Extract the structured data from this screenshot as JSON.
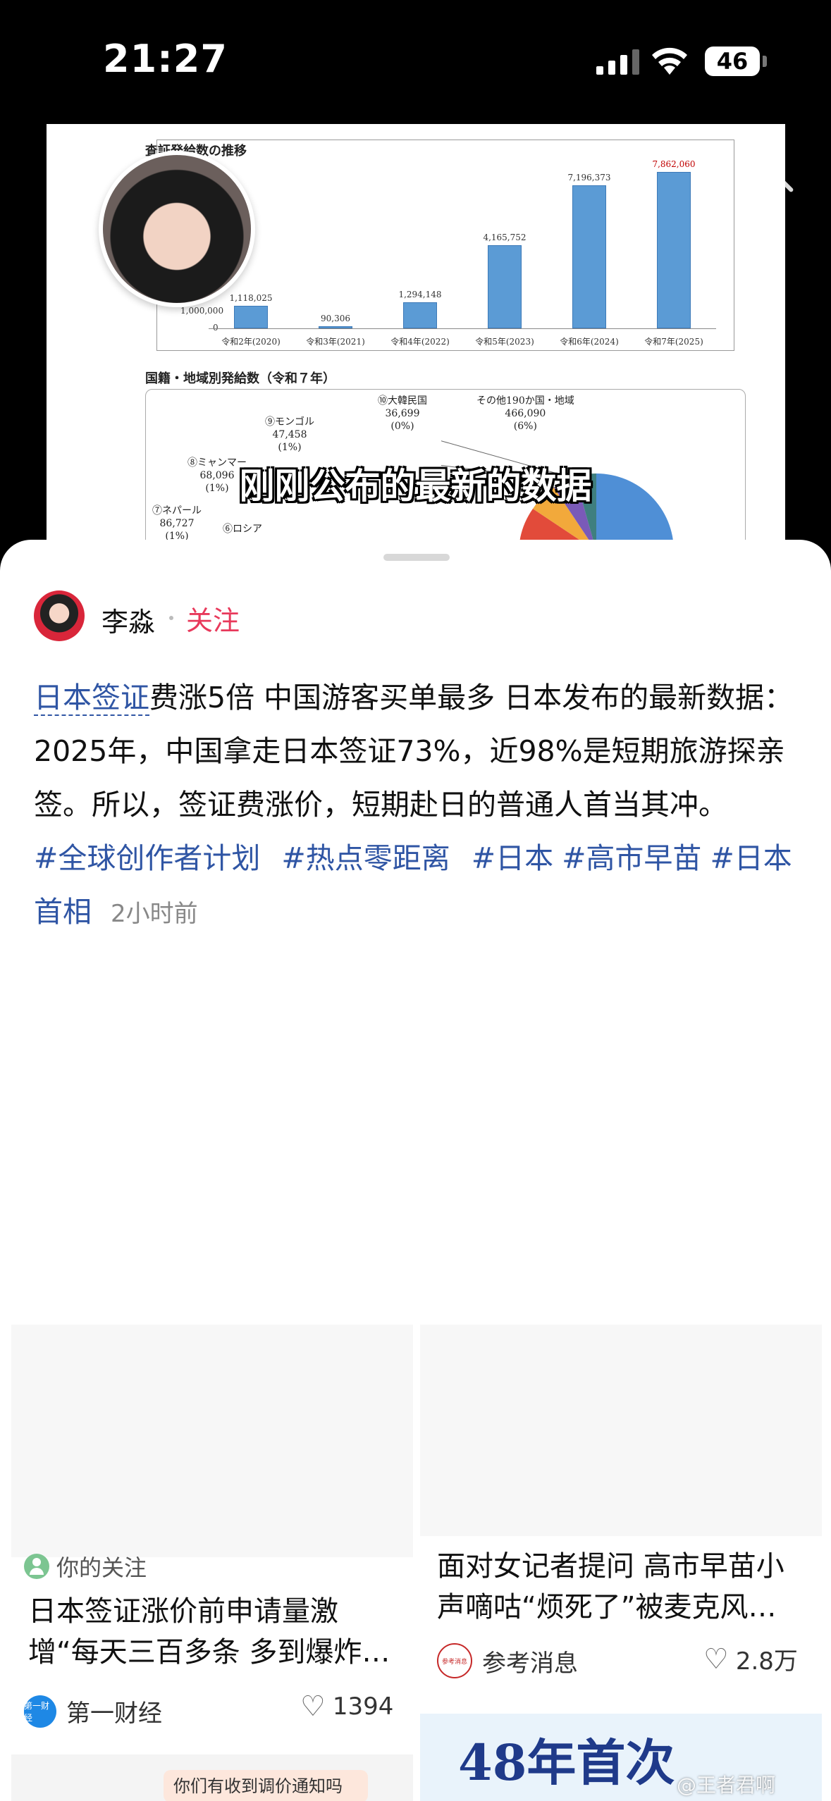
{
  "status": {
    "time": "21:27",
    "battery": "46"
  },
  "video": {
    "doc_title": "査証発給数の推移",
    "bar_chart": {
      "ytick_top": "1,000,000",
      "ytick_zero": "0",
      "items": [
        {
          "category": "令和2年(2020)",
          "value": 1118025,
          "label": "1,118,025"
        },
        {
          "category": "令和3年(2021)",
          "value": 90306,
          "label": "90,306"
        },
        {
          "category": "令和4年(2022)",
          "value": 1294148,
          "label": "1,294,148"
        },
        {
          "category": "令和5年(2023)",
          "value": 4165752,
          "label": "4,165,752"
        },
        {
          "category": "令和6年(2024)",
          "value": 7196373,
          "label": "7,196,373"
        },
        {
          "category": "令和7年(2025)",
          "value": 7862060,
          "label": "7,862,060"
        }
      ]
    },
    "pie_title": "国籍・地域別発給数（令和７年）",
    "pie_labels": {
      "korea": "⑩大韓民国\n36,699\n(0%)",
      "other": "その他190か国・地域\n466,090\n(6%)",
      "mongolia": "⑨モンゴル\n47,458\n(1%)",
      "myanmar": "⑧ミャンマー\n68,096\n(1%)",
      "nepal": "⑦ネパール\n86,727\n(1%)",
      "russia": "⑥ロシア"
    },
    "subtitle": "刚刚公布的最新的数据"
  },
  "author": {
    "name": "李淼",
    "follow_label": "关注"
  },
  "post": {
    "link_text": "日本签证",
    "body": "费涨5倍 中国游客买单最多 日本发布的最新数据：2025年，中国拿走日本签证73%，近98%是短期旅游探亲签。所以，签证费涨价，短期赴日的普通人首当其冲。",
    "tags": [
      "#全球创作者计划",
      "#热点零距离",
      "#日本",
      "#高市早苗",
      "#日本首相"
    ],
    "time": "2小时前"
  },
  "cards": {
    "left": {
      "follow_hint": "你的关注",
      "title": "日本签证涨价前申请量激增“每天三百多条 多到爆炸…",
      "source_logo": "第一财经",
      "source": "第一财经",
      "likes": "1394"
    },
    "right": {
      "title": "面对女记者提问 高市早苗小声嘀咕“烦死了”被麦克风…",
      "source_logo": "参考消息",
      "source": "参考消息",
      "likes": "2.8万"
    }
  },
  "bottom": {
    "left_notice": "你们有收到调价通知吗",
    "right_headline": "48年首次",
    "watermark": "@王者君啊"
  },
  "chart_data": {
    "type": "bar",
    "title": "査証発給数の推移",
    "categories": [
      "令和2年(2020)",
      "令和3年(2021)",
      "令和4年(2022)",
      "令和5年(2023)",
      "令和6年(2024)",
      "令和7年(2025)"
    ],
    "values": [
      1118025,
      90306,
      1294148,
      4165752,
      7196373,
      7862060
    ],
    "ylim": [
      0,
      8500000
    ]
  }
}
